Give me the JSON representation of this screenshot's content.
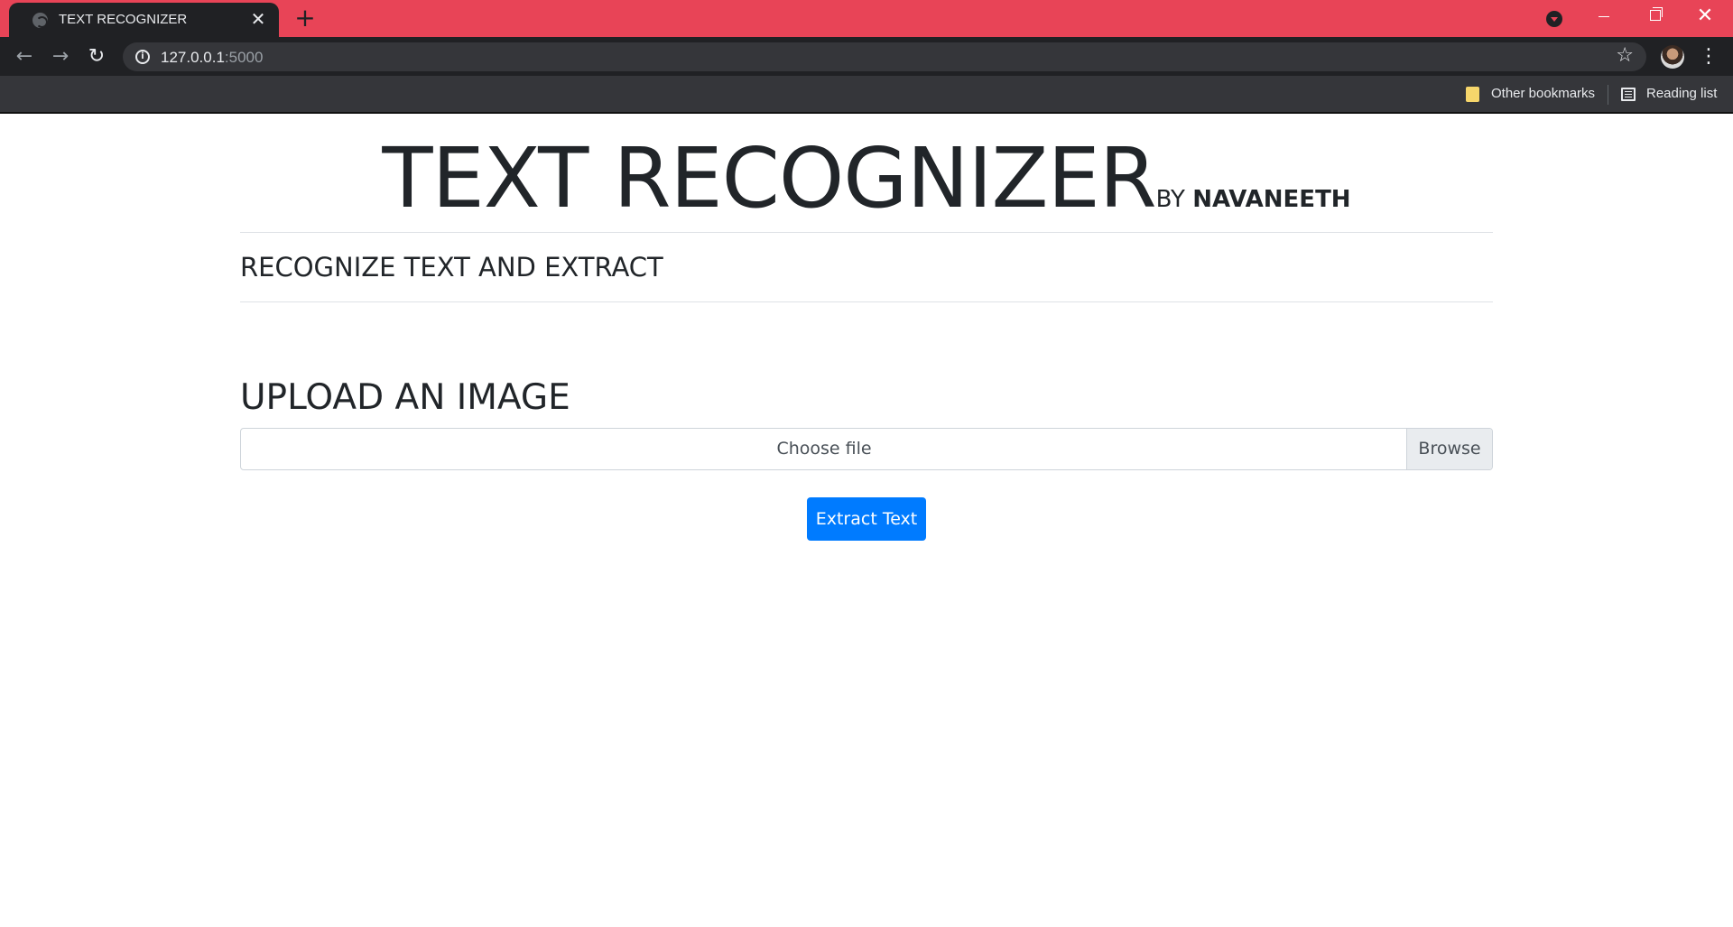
{
  "browser": {
    "tab_title": "TEXT RECOGNIZER",
    "tab_close": "✕",
    "new_tab": "+",
    "url_host": "127.0.0.1",
    "url_port": ":5000",
    "bookmarks": {
      "other": "Other bookmarks",
      "reading_list": "Reading list"
    },
    "colors": {
      "titlebar": "#e84457",
      "toolbar": "#202124"
    }
  },
  "page": {
    "title": "TEXT RECOGNIZER",
    "by_prefix": "BY ",
    "by_name": "NAVANEETH",
    "subtitle": "RECOGNIZE TEXT AND EXTRACT",
    "upload_heading": "UPLOAD AN IMAGE",
    "file_placeholder": "Choose file",
    "browse_label": "Browse",
    "extract_label": "Extract Text",
    "accent": "#007bff"
  }
}
